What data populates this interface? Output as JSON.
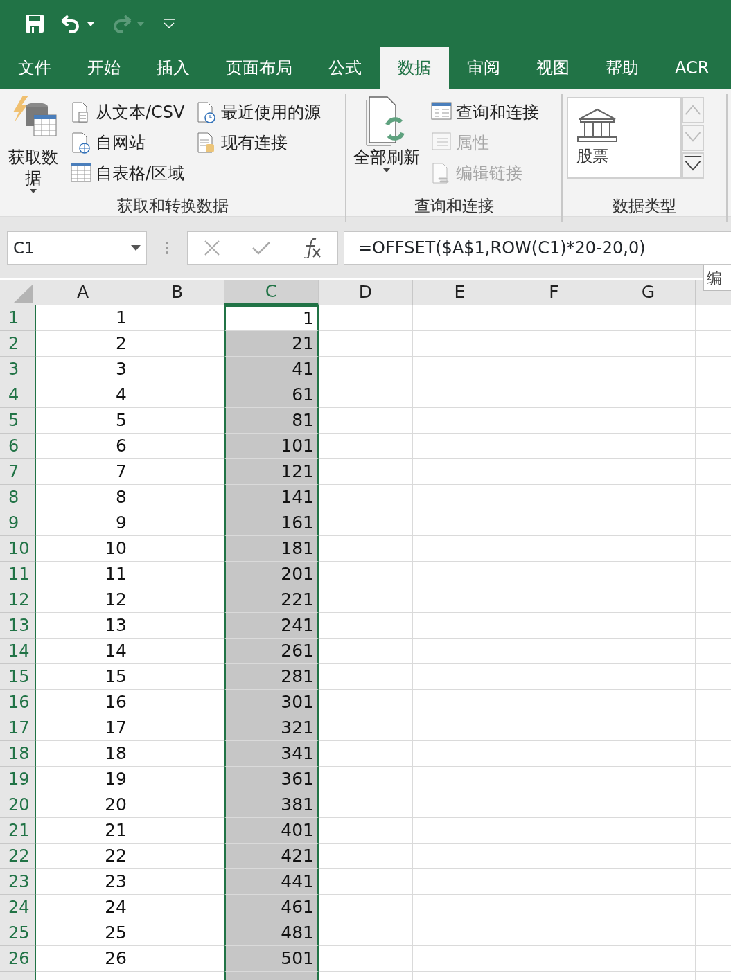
{
  "tabs": [
    {
      "label": "文件",
      "selected": false
    },
    {
      "label": "开始",
      "selected": false
    },
    {
      "label": "插入",
      "selected": false
    },
    {
      "label": "页面布局",
      "selected": false
    },
    {
      "label": "公式",
      "selected": false
    },
    {
      "label": "数据",
      "selected": true
    },
    {
      "label": "审阅",
      "selected": false
    },
    {
      "label": "视图",
      "selected": false
    },
    {
      "label": "帮助",
      "selected": false
    },
    {
      "label": "ACR",
      "selected": false
    }
  ],
  "ribbon_groups": [
    {
      "label": "获取和转换数据",
      "large": {
        "label": "获取数据"
      },
      "commands": [
        {
          "label": "从文本/CSV",
          "disabled": false
        },
        {
          "label": "自网站",
          "disabled": false
        },
        {
          "label": "自表格/区域",
          "disabled": false
        },
        {
          "label": "最近使用的源",
          "disabled": false
        },
        {
          "label": "现有连接",
          "disabled": false
        }
      ]
    },
    {
      "label": "查询和连接",
      "large": {
        "label": "全部刷新"
      },
      "commands": [
        {
          "label": "查询和连接",
          "disabled": false
        },
        {
          "label": "属性",
          "disabled": true
        },
        {
          "label": "编辑链接",
          "disabled": true
        }
      ]
    },
    {
      "label": "数据类型",
      "gallery": {
        "label": "股票"
      }
    }
  ],
  "name_box": "C1",
  "formula": "=OFFSET($A$1,ROW(C1)*20-20,0)",
  "tooltip": "编",
  "columns": [
    {
      "label": "A",
      "selected": false
    },
    {
      "label": "B",
      "selected": false
    },
    {
      "label": "C",
      "selected": true
    },
    {
      "label": "D",
      "selected": false
    },
    {
      "label": "E",
      "selected": false
    },
    {
      "label": "F",
      "selected": false
    },
    {
      "label": "G",
      "selected": false
    }
  ],
  "rows": [
    {
      "number": "1",
      "cells": [
        "1",
        "",
        "1"
      ],
      "active": true
    },
    {
      "number": "2",
      "cells": [
        "2",
        "",
        "21"
      ],
      "active": false
    },
    {
      "number": "3",
      "cells": [
        "3",
        "",
        "41"
      ],
      "active": false
    },
    {
      "number": "4",
      "cells": [
        "4",
        "",
        "61"
      ],
      "active": false
    },
    {
      "number": "5",
      "cells": [
        "5",
        "",
        "81"
      ],
      "active": false
    },
    {
      "number": "6",
      "cells": [
        "6",
        "",
        "101"
      ],
      "active": false
    },
    {
      "number": "7",
      "cells": [
        "7",
        "",
        "121"
      ],
      "active": false
    },
    {
      "number": "8",
      "cells": [
        "8",
        "",
        "141"
      ],
      "active": false
    },
    {
      "number": "9",
      "cells": [
        "9",
        "",
        "161"
      ],
      "active": false
    },
    {
      "number": "10",
      "cells": [
        "10",
        "",
        "181"
      ],
      "active": false
    },
    {
      "number": "11",
      "cells": [
        "11",
        "",
        "201"
      ],
      "active": false
    },
    {
      "number": "12",
      "cells": [
        "12",
        "",
        "221"
      ],
      "active": false
    },
    {
      "number": "13",
      "cells": [
        "13",
        "",
        "241"
      ],
      "active": false
    },
    {
      "number": "14",
      "cells": [
        "14",
        "",
        "261"
      ],
      "active": false
    },
    {
      "number": "15",
      "cells": [
        "15",
        "",
        "281"
      ],
      "active": false
    },
    {
      "number": "16",
      "cells": [
        "16",
        "",
        "301"
      ],
      "active": false
    },
    {
      "number": "17",
      "cells": [
        "17",
        "",
        "321"
      ],
      "active": false
    },
    {
      "number": "18",
      "cells": [
        "18",
        "",
        "341"
      ],
      "active": false
    },
    {
      "number": "19",
      "cells": [
        "19",
        "",
        "361"
      ],
      "active": false
    },
    {
      "number": "20",
      "cells": [
        "20",
        "",
        "381"
      ],
      "active": false
    },
    {
      "number": "21",
      "cells": [
        "21",
        "",
        "401"
      ],
      "active": false
    },
    {
      "number": "22",
      "cells": [
        "22",
        "",
        "421"
      ],
      "active": false
    },
    {
      "number": "23",
      "cells": [
        "23",
        "",
        "441"
      ],
      "active": false
    },
    {
      "number": "24",
      "cells": [
        "24",
        "",
        "461"
      ],
      "active": false
    },
    {
      "number": "25",
      "cells": [
        "25",
        "",
        "481"
      ],
      "active": false
    },
    {
      "number": "26",
      "cells": [
        "26",
        "",
        "501"
      ],
      "active": false
    }
  ]
}
